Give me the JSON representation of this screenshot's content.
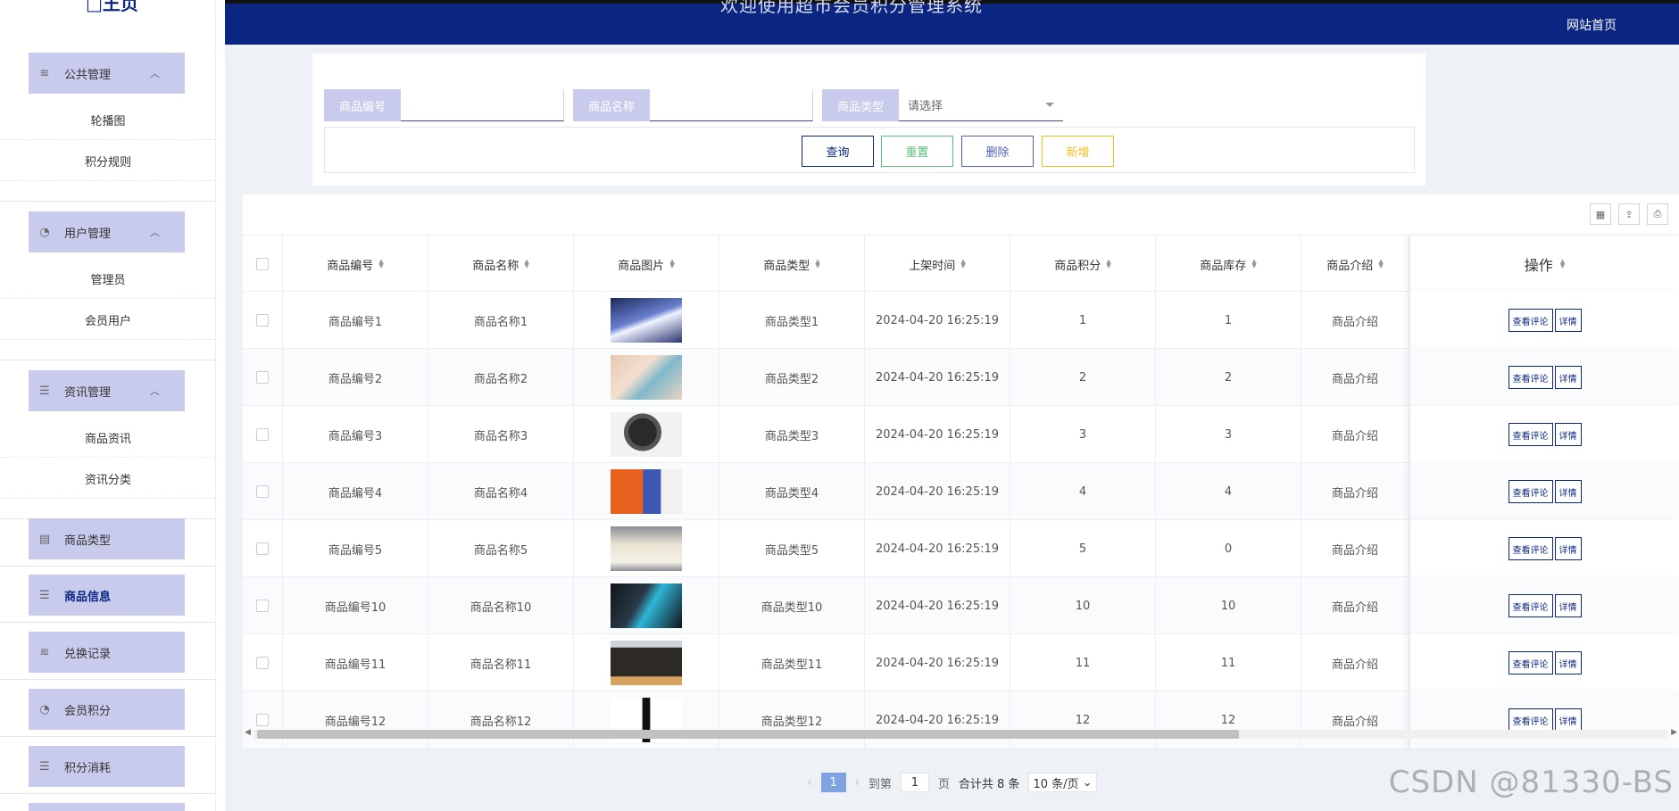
{
  "header": {
    "title": "欢迎使用超市会员积分管理系统",
    "home_link": "网站首页"
  },
  "logo_text": "□王页",
  "sidebar": {
    "groups": [
      {
        "label": "公共管理",
        "icon": "layers-icon",
        "items": [
          "轮播图",
          "积分规则"
        ]
      },
      {
        "label": "用户管理",
        "icon": "alarm-icon",
        "items": [
          "管理员",
          "会员用户"
        ]
      },
      {
        "label": "资讯管理",
        "icon": "list-icon",
        "items": [
          "商品资讯",
          "资讯分类"
        ]
      }
    ],
    "singles": [
      {
        "label": "商品类型",
        "icon": "doc-icon"
      },
      {
        "label": "商品信息",
        "icon": "list-icon",
        "active": true
      },
      {
        "label": "兑换记录",
        "icon": "layers-icon"
      },
      {
        "label": "会员积分",
        "icon": "alarm-icon"
      },
      {
        "label": "积分消耗",
        "icon": "list-icon"
      }
    ]
  },
  "search": {
    "code_label": "商品编号",
    "code_value": "",
    "name_label": "商品名称",
    "name_value": "",
    "type_label": "商品类型",
    "type_selected": "请选择"
  },
  "buttons": {
    "query": "查询",
    "reset": "重置",
    "delete": "删除",
    "add": "新增"
  },
  "table": {
    "columns": [
      "商品编号",
      "商品名称",
      "商品图片",
      "商品类型",
      "上架时间",
      "商品积分",
      "商品库存",
      "商品介绍",
      "操作"
    ],
    "rows": [
      {
        "code": "商品编号1",
        "name": "商品名称1",
        "type": "商品类型1",
        "time": "2024-04-20 16:25:19",
        "points": "1",
        "stock": "1",
        "intro": "商品介绍"
      },
      {
        "code": "商品编号2",
        "name": "商品名称2",
        "type": "商品类型2",
        "time": "2024-04-20 16:25:19",
        "points": "2",
        "stock": "2",
        "intro": "商品介绍"
      },
      {
        "code": "商品编号3",
        "name": "商品名称3",
        "type": "商品类型3",
        "time": "2024-04-20 16:25:19",
        "points": "3",
        "stock": "3",
        "intro": "商品介绍"
      },
      {
        "code": "商品编号4",
        "name": "商品名称4",
        "type": "商品类型4",
        "time": "2024-04-20 16:25:19",
        "points": "4",
        "stock": "4",
        "intro": "商品介绍"
      },
      {
        "code": "商品编号5",
        "name": "商品名称5",
        "type": "商品类型5",
        "time": "2024-04-20 16:25:19",
        "points": "5",
        "stock": "0",
        "intro": "商品介绍"
      },
      {
        "code": "商品编号10",
        "name": "商品名称10",
        "type": "商品类型10",
        "time": "2024-04-20 16:25:19",
        "points": "10",
        "stock": "10",
        "intro": "商品介绍"
      },
      {
        "code": "商品编号11",
        "name": "商品名称11",
        "type": "商品类型11",
        "time": "2024-04-20 16:25:19",
        "points": "11",
        "stock": "11",
        "intro": "商品介绍"
      },
      {
        "code": "商品编号12",
        "name": "商品名称12",
        "type": "商品类型12",
        "time": "2024-04-20 16:25:19",
        "points": "12",
        "stock": "12",
        "intro": "商品介绍"
      }
    ],
    "op_comment": "查看评论",
    "op_detail": "详情"
  },
  "pager": {
    "current": "1",
    "goto_label": "到第",
    "goto_value": "1",
    "page_unit": "页",
    "total": "合计共 8 条",
    "page_size": "10 条/页"
  },
  "watermark": "CSDN @81330-BS",
  "colors": {
    "header": "#0b2681",
    "menu_bg": "#c8cbec",
    "query": "#0b2681",
    "reset": "#5fbf7a",
    "delete": "#4e5fb5",
    "add": "#f0c020"
  }
}
